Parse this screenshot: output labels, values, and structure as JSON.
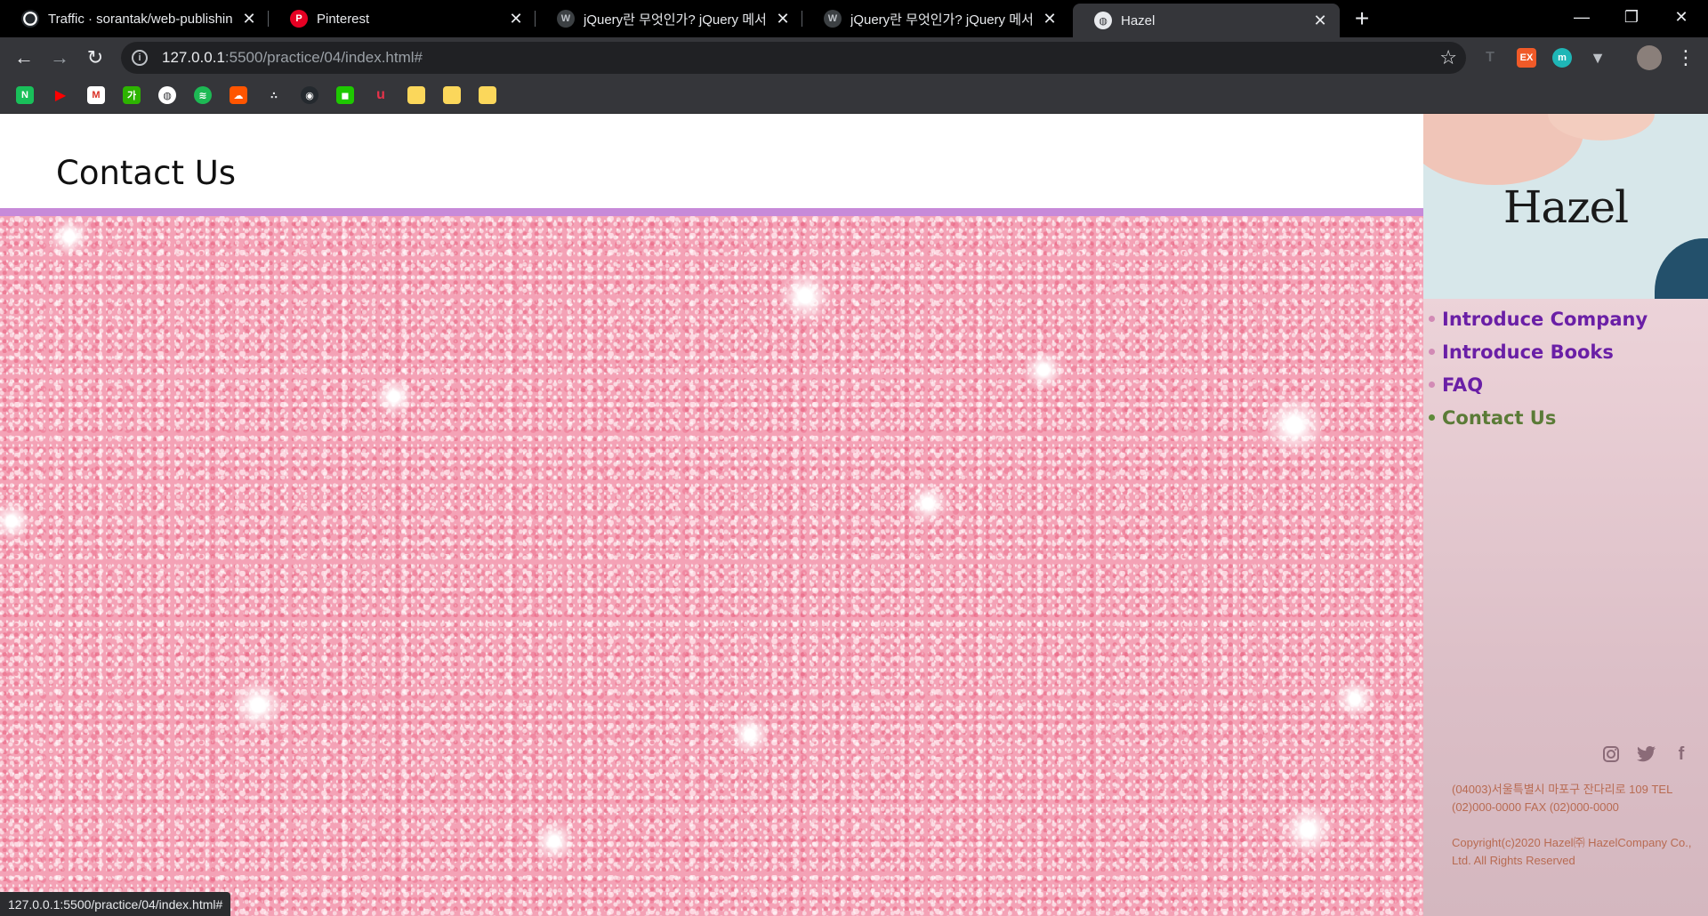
{
  "browser": {
    "tabs": [
      {
        "title": "Traffic · sorantak/web-publishin",
        "favicon": "github-icon",
        "active": false
      },
      {
        "title": "Pinterest",
        "favicon": "pinterest-icon",
        "active": false
      },
      {
        "title": "jQuery란 무엇인가? jQuery 메서",
        "favicon": "site-icon",
        "active": false
      },
      {
        "title": "jQuery란 무엇인가? jQuery 메서",
        "favicon": "site-icon",
        "active": false
      },
      {
        "title": "Hazel",
        "favicon": "globe-icon",
        "active": true
      }
    ],
    "url_host": "127.0.0.1",
    "url_path": ":5500/practice/04/index.html#",
    "status_url": "127.0.0.1:5500/practice/04/index.html#"
  },
  "page": {
    "title": "Contact Us",
    "logo": "Hazel",
    "menu": [
      {
        "label": "Introduce Company",
        "current": false
      },
      {
        "label": "Introduce Books",
        "current": false
      },
      {
        "label": "FAQ",
        "current": false
      },
      {
        "label": "Contact Us",
        "current": true
      }
    ],
    "address": "(04003)서울특별시 마포구 잔다리로 109 TEL (02)000-0000 FAX (02)000-0000",
    "copyright": "Copyright(c)2020 Hazel㈜ HazelCompany Co., Ltd. All Rights Reserved",
    "social_icons": [
      "instagram-icon",
      "twitter-icon",
      "facebook-icon"
    ]
  },
  "colors": {
    "accent_purple": "#c78ad9",
    "menu_link": "#6a1fa6",
    "menu_current": "#5b7b37",
    "footer_text": "#b86b52"
  }
}
